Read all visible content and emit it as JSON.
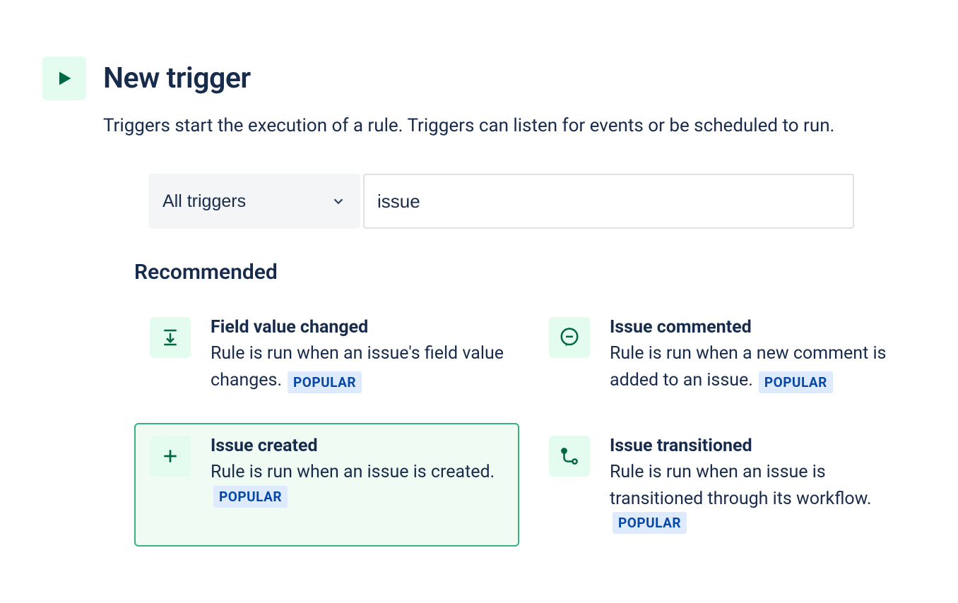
{
  "header": {
    "title": "New trigger",
    "subtitle": "Triggers start the execution of a rule. Triggers can listen for events or be scheduled to run."
  },
  "controls": {
    "dropdown_label": "All triggers",
    "search_value": "issue"
  },
  "section": {
    "title": "Recommended"
  },
  "badge_text": "POPULAR",
  "cards": [
    {
      "title": "Field value changed",
      "desc": "Rule is run when an issue's field value changes.",
      "popular": true,
      "selected": false,
      "icon": "download"
    },
    {
      "title": "Issue commented",
      "desc": "Rule is run when a new comment is added to an issue.",
      "popular": true,
      "selected": false,
      "icon": "comment"
    },
    {
      "title": "Issue created",
      "desc": "Rule is run when an issue is created.",
      "popular": true,
      "selected": true,
      "icon": "plus"
    },
    {
      "title": "Issue transitioned",
      "desc": "Rule is run when an issue is transitioned through its workflow.",
      "popular": true,
      "selected": false,
      "icon": "transition"
    }
  ]
}
